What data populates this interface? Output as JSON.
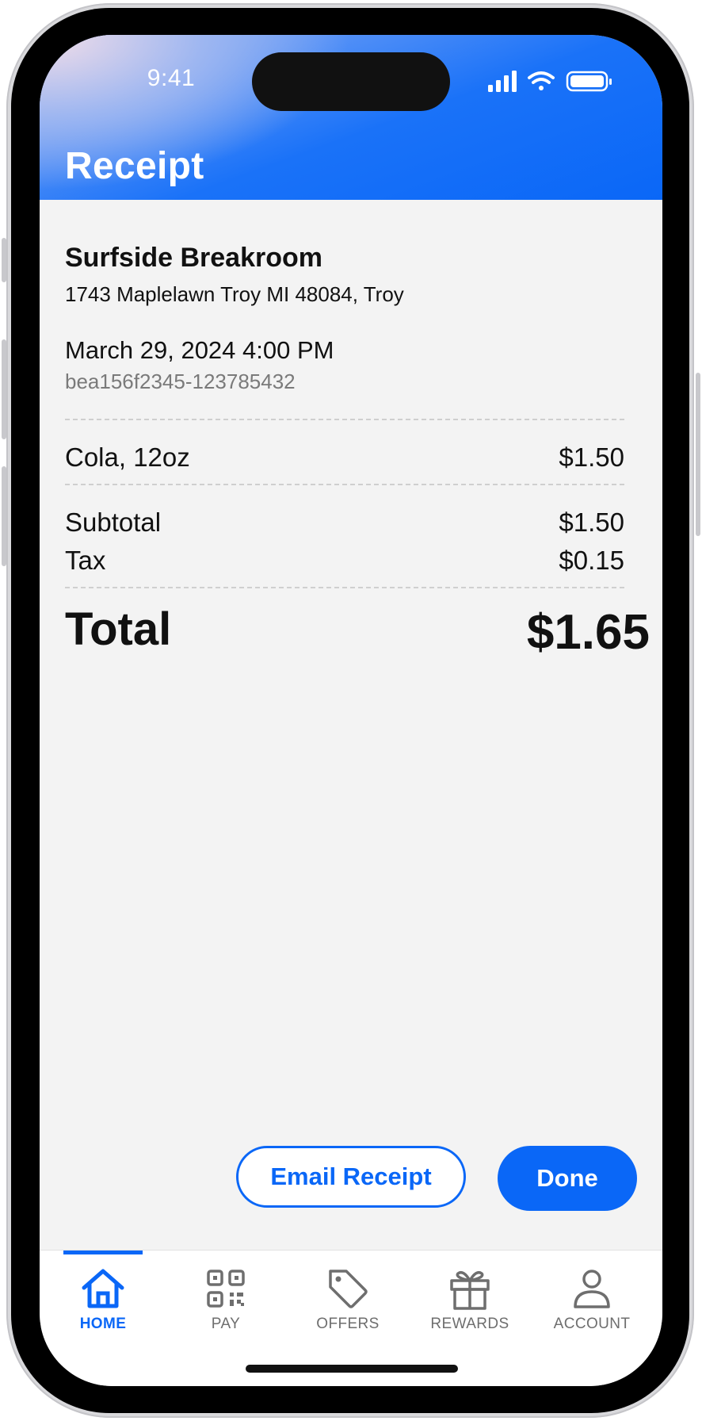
{
  "status_bar": {
    "time": "9:41"
  },
  "header": {
    "title": "Receipt"
  },
  "receipt": {
    "store_name": "Surfside Breakroom",
    "store_address": "1743 Maplelawn Troy MI 48084, Troy",
    "date_time": "March 29, 2024 4:00 PM",
    "transaction_id": "bea156f2345-123785432",
    "items": [
      {
        "name": "Cola, 12oz",
        "price": "$1.50"
      }
    ],
    "subtotal_label": "Subtotal",
    "subtotal": "$1.50",
    "tax_label": "Tax",
    "tax": "$0.15",
    "total_label": "Total",
    "total": "$1.65"
  },
  "actions": {
    "email_receipt_label": "Email Receipt",
    "done_label": "Done"
  },
  "tab_bar": {
    "active": "home",
    "tabs": [
      {
        "label": "HOME",
        "icon": "home-icon"
      },
      {
        "label": "PAY",
        "icon": "qr-code-icon"
      },
      {
        "label": "OFFERS",
        "icon": "tag-icon"
      },
      {
        "label": "REWARDS",
        "icon": "gift-icon"
      },
      {
        "label": "ACCOUNT",
        "icon": "user-icon"
      }
    ]
  },
  "colors": {
    "accent": "#0a67f7",
    "background": "#f3f3f3",
    "text": "#111111",
    "muted_text": "#7a7a7a"
  }
}
